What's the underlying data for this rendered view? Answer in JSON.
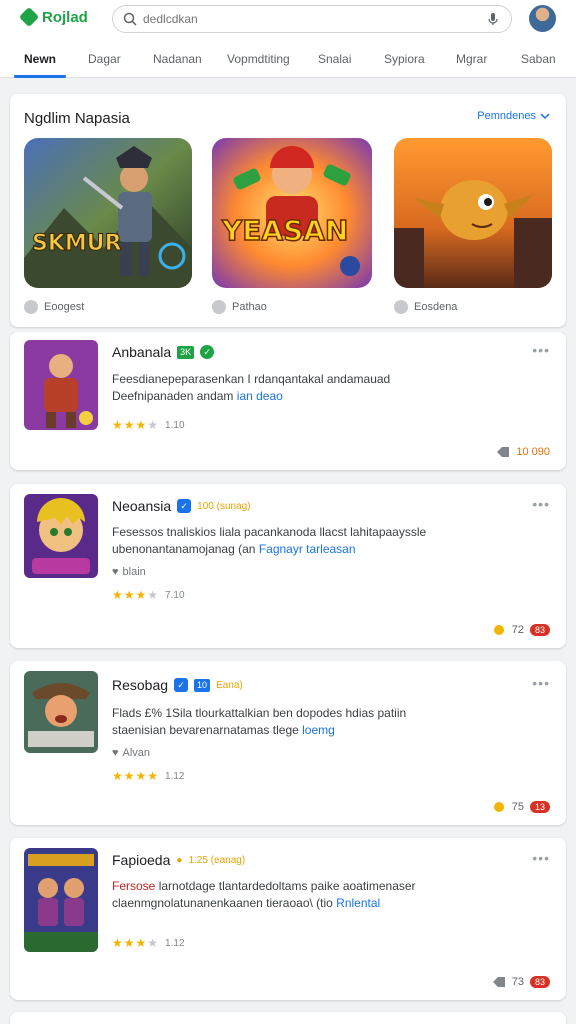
{
  "header": {
    "logo_text": "Rojlad",
    "search_placeholder": "dedlcdkan",
    "avatar_alt": "user"
  },
  "tabs": [
    {
      "label": "Newn"
    },
    {
      "label": "Dagar"
    },
    {
      "label": "Nadanan"
    },
    {
      "label": "Vopmdtiting"
    },
    {
      "label": "Snalai"
    },
    {
      "label": "Sypiora"
    },
    {
      "label": "Mgrar"
    },
    {
      "label": "Saban"
    }
  ],
  "featured": {
    "title": "Ngdlim Napasia",
    "link": "Pemndenes",
    "items": [
      {
        "art_text": "SKMUR",
        "caption": "Eoogest"
      },
      {
        "art_text": "YEASAN",
        "caption": "Pathao"
      },
      {
        "art_text": "",
        "caption": "Eosdena"
      }
    ]
  },
  "apps": [
    {
      "title": "Anbanala",
      "badge": "3K",
      "desc_a": "Feesdianepeparasenkan I rdanqantakal andamauad",
      "desc_b": "Deefnipanaden andam",
      "desc_hl": "ian deao",
      "meta": "",
      "rating": 3,
      "rating_text": "1.10",
      "foot_count": "10 090"
    },
    {
      "title": "Neoansia",
      "badge": "",
      "tag": "100 (sunag)",
      "desc_a": "Fesessos tnaliskios liala pacankanoda llacst lahitapaayssle",
      "desc_b": "ubenonantanamojanag (an",
      "desc_hl": "Fagnayr tarleasan",
      "meta": "blain",
      "rating": 3.5,
      "rating_text": "7.10",
      "foot_count": "72",
      "foot_pill": "83"
    },
    {
      "title": "Resobag",
      "badge": "10",
      "tag": "Eana)",
      "desc_a": "Flads £% 1Sila tlourkattalkian ben dopodes hdias patiin",
      "desc_b": "staenisian bevarenarnatamas tlege",
      "desc_hl": "loemg",
      "meta": "Alvan",
      "rating": 4,
      "rating_text": "1.12",
      "foot_count": "75",
      "foot_pill": "13"
    },
    {
      "title": "Fapioeda",
      "badge": "",
      "tag": "1.25 (eanag)",
      "desc_a_red": "Fersose",
      "desc_a": "larnotdage tlantardedoltams paike aoatimenaser",
      "desc_b": "claenmgnolatunanenkaanen tieraoao\\ (tio",
      "desc_hl": "Rnlental",
      "meta": "",
      "rating": 3.5,
      "rating_text": "1.12",
      "foot_count": "73",
      "foot_pill": "83"
    }
  ],
  "colors": {
    "accent": "#1a73e8",
    "brand": "#1ea446",
    "star": "#f4b400",
    "pill_red": "#d93025"
  }
}
